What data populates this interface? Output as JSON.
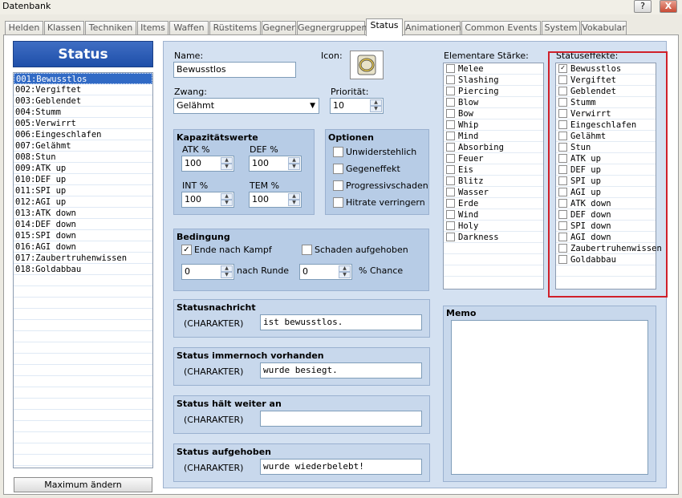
{
  "window": {
    "title": "Datenbank",
    "help_label": "?",
    "close_label": "X"
  },
  "tabs": [
    "Helden",
    "Klassen",
    "Techniken",
    "Items",
    "Waffen",
    "Rüstitems",
    "Gegner",
    "Gegnergruppen",
    "Status",
    "Animationen",
    "Common Events",
    "System",
    "Vokabular"
  ],
  "active_tab": "Status",
  "left": {
    "header": "Status",
    "items": [
      "001:Bewusstlos",
      "002:Vergiftet",
      "003:Geblendet",
      "004:Stumm",
      "005:Verwirrt",
      "006:Eingeschlafen",
      "007:Gelähmt",
      "008:Stun",
      "009:ATK up",
      "010:DEF up",
      "011:SPI up",
      "012:AGI up",
      "013:ATK down",
      "014:DEF down",
      "015:SPI down",
      "016:AGI down",
      "017:Zaubertruhenwissen",
      "018:Goldabbau"
    ],
    "selected_index": 0,
    "max_button": "Maximum ändern"
  },
  "form": {
    "name_label": "Name:",
    "name_value": "Bewusstlos",
    "icon_label": "Icon:",
    "zwang_label": "Zwang:",
    "zwang_value": "Gelähmt",
    "prio_label": "Priorität:",
    "prio_value": "10",
    "kap_title": "Kapazitätswerte",
    "atk_label": "ATK %",
    "atk_value": "100",
    "def_label": "DEF %",
    "def_value": "100",
    "int_label": "INT %",
    "int_value": "100",
    "tem_label": "TEM %",
    "tem_value": "100",
    "opt_title": "Optionen",
    "options": [
      {
        "label": "Unwiderstehlich",
        "checked": false
      },
      {
        "label": "Gegeneffekt",
        "checked": false
      },
      {
        "label": "Progressivschaden",
        "checked": false
      },
      {
        "label": "Hitrate verringern",
        "checked": false
      }
    ],
    "bed_title": "Bedingung",
    "ende_label": "Ende nach Kampf",
    "ende_checked": true,
    "schaden_label": "Schaden aufgehoben",
    "schaden_checked": false,
    "runde_value": "0",
    "runde_label": "nach Runde",
    "chance_value": "0",
    "chance_label": "% Chance",
    "messages": [
      {
        "title": "Statusnachricht",
        "actor": "(CHARAKTER)",
        "text": "ist bewusstlos."
      },
      {
        "title": "Status immernoch vorhanden",
        "actor": "(CHARAKTER)",
        "text": "wurde besiegt."
      },
      {
        "title": "Status hält weiter an",
        "actor": "(CHARAKTER)",
        "text": ""
      },
      {
        "title": "Status aufgehoben",
        "actor": "(CHARAKTER)",
        "text": "wurde wiederbelebt!"
      }
    ]
  },
  "elements": {
    "label": "Elementare Stärke:",
    "items": [
      "Melee",
      "Slashing",
      "Piercing",
      "Blow",
      "Bow",
      "Whip",
      "Mind",
      "Absorbing",
      "Feuer",
      "Eis",
      "Blitz",
      "Wasser",
      "Erde",
      "Wind",
      "Holy",
      "Darkness"
    ]
  },
  "effects": {
    "label": "Statuseffekte:",
    "items": [
      "Bewusstlos",
      "Vergiftet",
      "Geblendet",
      "Stumm",
      "Verwirrt",
      "Eingeschlafen",
      "Gelähmt",
      "Stun",
      "ATK up",
      "DEF up",
      "SPI up",
      "AGI up",
      "ATK down",
      "DEF down",
      "SPI down",
      "AGI down",
      "Zaubertruhenwissen",
      "Goldabbau"
    ],
    "checked_index": 0
  },
  "memo": {
    "label": "Memo",
    "text": ""
  },
  "colors": {
    "highlight": "#d0202a",
    "selection": "#316ac5",
    "panel": "#d4e1f1",
    "group": "#b7cce6"
  }
}
